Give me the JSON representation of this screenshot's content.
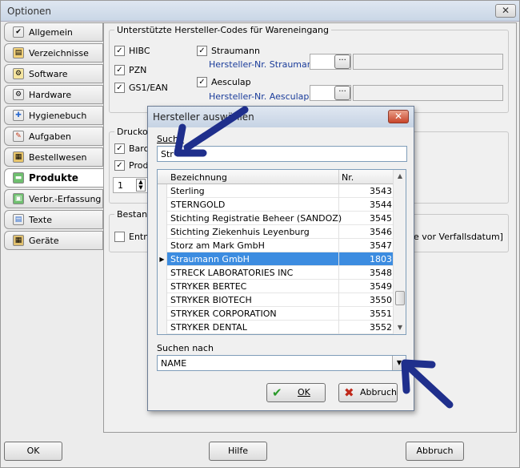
{
  "window": {
    "title": "Optionen",
    "close": "✕"
  },
  "tabs": [
    {
      "label": "Allgemein",
      "icon": "✔"
    },
    {
      "label": "Verzeichnisse",
      "icon": "▤"
    },
    {
      "label": "Software",
      "icon": "⚙"
    },
    {
      "label": "Hardware",
      "icon": "⚙"
    },
    {
      "label": "Hygienebuch",
      "icon": "✚"
    },
    {
      "label": "Aufgaben",
      "icon": "✎"
    },
    {
      "label": "Bestellwesen",
      "icon": "▦"
    },
    {
      "label": "Produkte",
      "icon": "▬"
    },
    {
      "label": "Verbr.-Erfassung",
      "icon": "▣"
    },
    {
      "label": "Texte",
      "icon": "▤"
    },
    {
      "label": "Geräte",
      "icon": "▦"
    }
  ],
  "codes": {
    "caption": "Unterstützte Hersteller-Codes für Wareneingang",
    "hibc": "HIBC",
    "pzn": "PZN",
    "gs1": "GS1/EAN",
    "straumann": "Straumann",
    "straumann_nr": "Hersteller-Nr. Straumann",
    "aesculap": "Aesculap",
    "aesculap_nr": "Hersteller-Nr. Aesculap",
    "dots": "···"
  },
  "druck": {
    "caption": "Druckop",
    "barcode": "Barco",
    "produkt": "Produ",
    "spin_value": "1"
  },
  "bestand": {
    "caption": "Bestands",
    "entn": "Entna",
    "verfall": "e vor Verfallsdatum]"
  },
  "footer": {
    "ok": "OK",
    "hilfe": "Hilfe",
    "abbruch": "Abbruch"
  },
  "dialog": {
    "title": "Hersteller auswählen",
    "close": "✕",
    "search_label": "Suche",
    "search_value": "Str",
    "col_name": "Bezeichnung",
    "col_nr": "Nr.",
    "rows": [
      {
        "name": "Sterling",
        "nr": "3543"
      },
      {
        "name": "STERNGOLD",
        "nr": "3544"
      },
      {
        "name": "Stichting Registratie Beheer (SANDOZ)",
        "nr": "3545"
      },
      {
        "name": "Stichting Ziekenhuis Leyenburg",
        "nr": "3546"
      },
      {
        "name": "Storz am Mark GmbH",
        "nr": "3547"
      },
      {
        "name": "Straumann GmbH",
        "nr": "1803"
      },
      {
        "name": "STRECK LABORATORIES INC",
        "nr": "3548"
      },
      {
        "name": "STRYKER BERTEC",
        "nr": "3549"
      },
      {
        "name": "STRYKER BIOTECH",
        "nr": "3550"
      },
      {
        "name": "STRYKER CORPORATION",
        "nr": "3551"
      },
      {
        "name": "STRYKER DENTAL",
        "nr": "3552"
      }
    ],
    "search_by_label": "Suchen nach",
    "search_by_value": "NAME",
    "ok": "OK",
    "cancel": "Abbruch"
  },
  "colors": {
    "selection": "#3c8ce0",
    "arrow": "#1f2f8c",
    "label_blue": "#1a3c9a"
  }
}
